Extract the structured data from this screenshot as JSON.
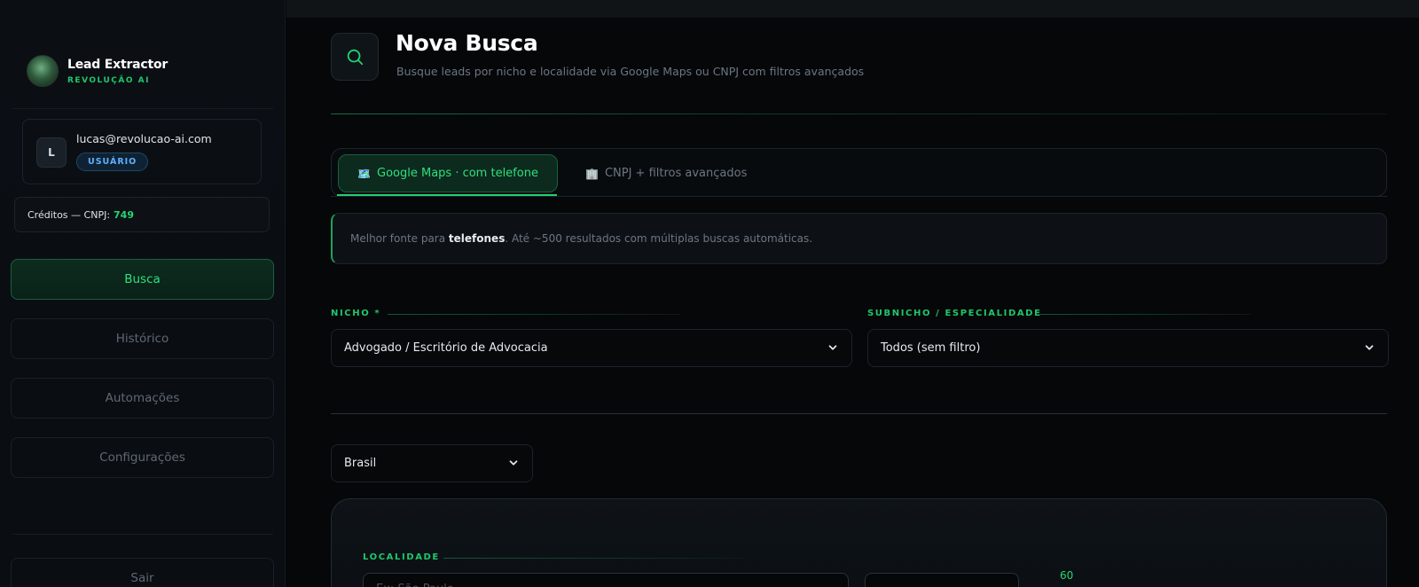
{
  "sidebar": {
    "brand_title": "Lead Extractor",
    "brand_subtitle": "REVOLUÇÃO AI",
    "user_initial": "L",
    "user_email": "lucas@revolucao-ai.com",
    "user_role": "USUÁRIO",
    "credits_label": "Créditos — CNPJ:",
    "credits_value": "749",
    "nav": [
      {
        "label": "Busca",
        "active": true
      },
      {
        "label": "Histórico",
        "active": false
      },
      {
        "label": "Automações",
        "active": false
      },
      {
        "label": "Configurações",
        "active": false
      }
    ],
    "logout_label": "Sair"
  },
  "header": {
    "icon": "search-icon",
    "title": "Nova Busca",
    "subtitle": "Busque leads por nicho e localidade via Google Maps ou CNPJ com filtros avançados"
  },
  "tabs": [
    {
      "emoji": "🗺️",
      "label": "Google Maps · com telefone",
      "active": true
    },
    {
      "emoji": "🏢",
      "label": "CNPJ + filtros avançados",
      "active": false
    }
  ],
  "info": {
    "prefix": "Melhor fonte para ",
    "bold": "telefones",
    "suffix": ". Até ~500 resultados com múltiplas buscas automáticas."
  },
  "form": {
    "niche_label": "NICHO *",
    "niche_value": "Advogado / Escritório de Advocacia",
    "subniche_label": "SUBNICHO / ESPECIALIDADE",
    "subniche_value": "Todos (sem filtro)",
    "country_value": "Brasil",
    "locality_label": "LOCALIDADE",
    "locality_placeholder": "Ex: São Paulo",
    "locality_count": "60"
  },
  "colors": {
    "accent": "#22d072",
    "background": "#050709",
    "badge_blue": "#5fb0ff"
  }
}
